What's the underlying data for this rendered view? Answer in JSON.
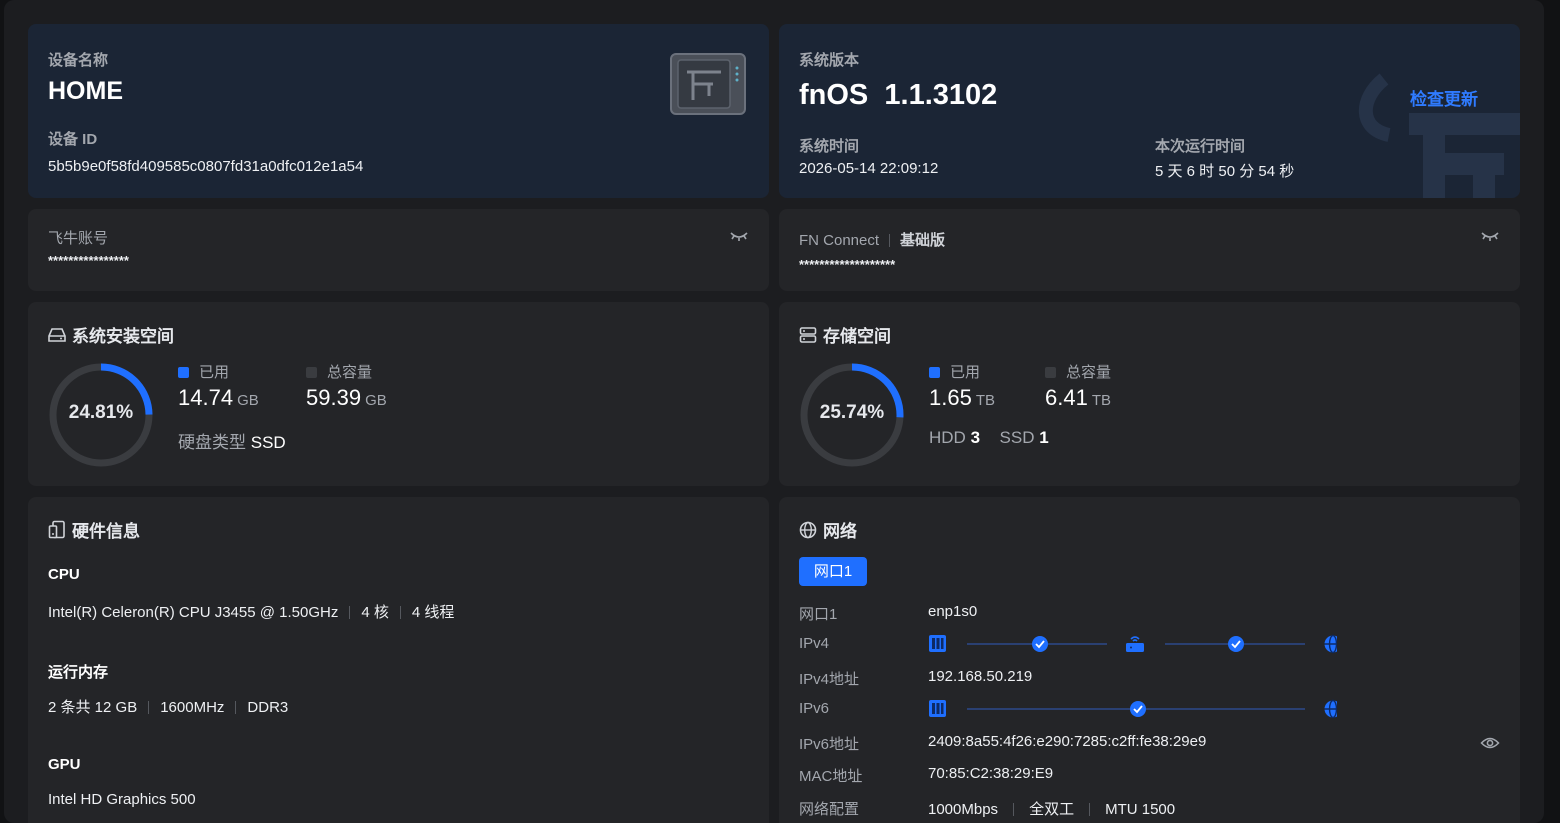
{
  "device": {
    "name_label": "设备名称",
    "name": "HOME",
    "id_label": "设备 ID",
    "id": "5b5b9e0f58fd409585c0807fd31a0dfc012e1a54"
  },
  "system": {
    "version_label": "系统版本",
    "version": "fnOS  1.1.3102",
    "check_update": "检查更新",
    "time_label": "系统时间",
    "time": "2026-05-14 22:09:12",
    "uptime_label": "本次运行时间",
    "uptime": "5 天 6 时 50 分 54 秒"
  },
  "account": {
    "label": "飞牛账号",
    "value": "****************"
  },
  "fnconnect": {
    "label": "FN Connect",
    "tier": "基础版",
    "value": "*******************"
  },
  "sys_space": {
    "title": "系统安装空间",
    "percent_label": "24.81%",
    "percent": 24.81,
    "used_label": "已用",
    "used_value": "14.74",
    "used_unit": "GB",
    "total_label": "总容量",
    "total_value": "59.39",
    "total_unit": "GB",
    "disk_type_label": "硬盘类型",
    "disk_type": "SSD"
  },
  "storage": {
    "title": "存储空间",
    "percent_label": "25.74%",
    "percent": 25.74,
    "used_label": "已用",
    "used_value": "1.65",
    "used_unit": "TB",
    "total_label": "总容量",
    "total_value": "6.41",
    "total_unit": "TB",
    "hdd_label": "HDD",
    "hdd_count": "3",
    "ssd_label": "SSD",
    "ssd_count": "1"
  },
  "hardware": {
    "title": "硬件信息",
    "cpu_label": "CPU",
    "cpu_model": "Intel(R) Celeron(R) CPU J3455 @ 1.50GHz",
    "cpu_cores": "4 核",
    "cpu_threads": "4 线程",
    "ram_label": "运行内存",
    "ram_count": "2 条共 12 GB",
    "ram_speed": "1600MHz",
    "ram_type": "DDR3",
    "gpu_label": "GPU",
    "gpu_model": "Intel HD Graphics 500"
  },
  "network": {
    "title": "网络",
    "tab": "网口1",
    "iface_label": "网口1",
    "iface": "enp1s0",
    "ipv4_label": "IPv4",
    "ipv4_addr_label": "IPv4地址",
    "ipv4_addr": "192.168.50.219",
    "ipv6_label": "IPv6",
    "ipv6_addr_label": "IPv6地址",
    "ipv6_addr": "2409:8a55:4f26:e290:7285:c2ff:fe38:29e9",
    "mac_label": "MAC地址",
    "mac": "70:85:C2:38:29:E9",
    "config_label": "网络配置",
    "speed": "1000Mbps",
    "duplex": "全双工",
    "mtu": "MTU 1500"
  },
  "colors": {
    "accent": "#1f6fff",
    "ring_track": "#3a3c40",
    "card": "#242528",
    "card_blue": "#1b2535"
  },
  "icons": [
    "nas-device-icon",
    "eye-closed-icon",
    "eye-open-icon",
    "hdd-icon",
    "storage-icon",
    "hardware-icon",
    "globe-icon",
    "nas-node-icon",
    "router-node-icon",
    "internet-node-icon",
    "check-icon",
    "fnos-logo-watermark"
  ]
}
